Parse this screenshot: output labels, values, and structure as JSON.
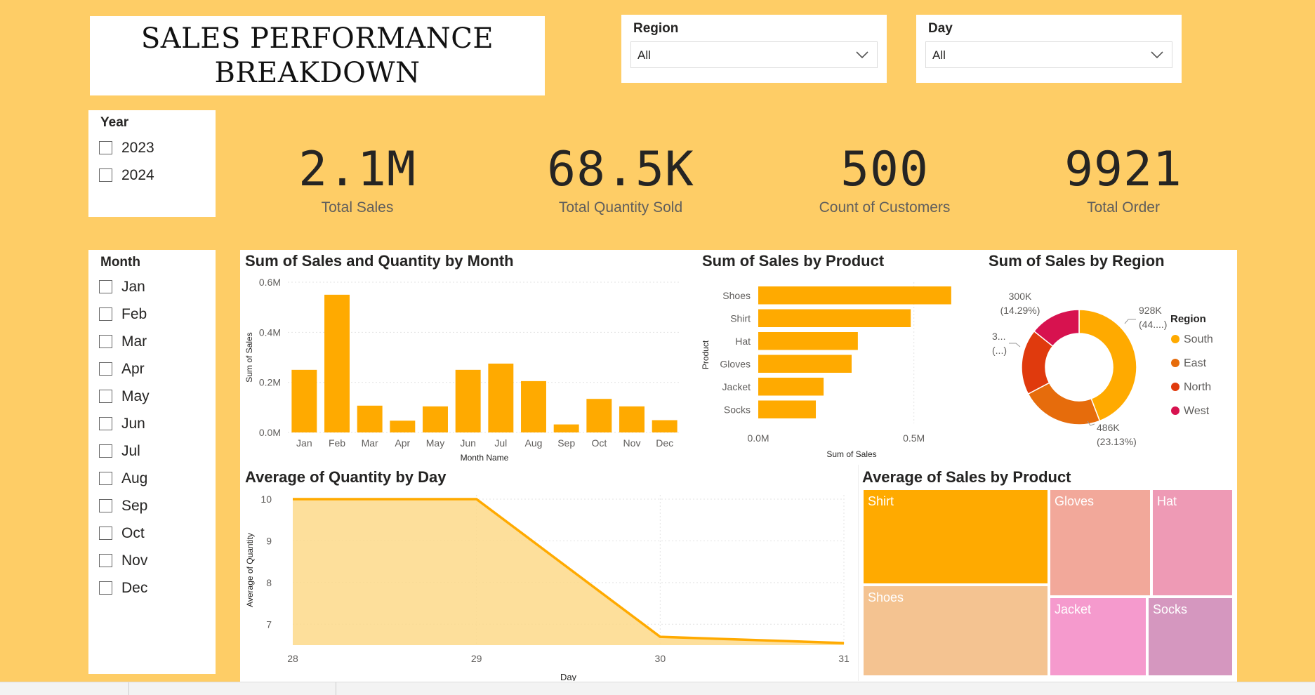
{
  "title": "SALES PERFORMANCE BREAKDOWN",
  "filters": {
    "region": {
      "label": "Region",
      "value": "All"
    },
    "day": {
      "label": "Day",
      "value": "All"
    }
  },
  "year_slicer": {
    "label": "Year",
    "options": [
      "2023",
      "2024"
    ]
  },
  "month_slicer": {
    "label": "Month",
    "options": [
      "Jan",
      "Feb",
      "Mar",
      "Apr",
      "May",
      "Jun",
      "Jul",
      "Aug",
      "Sep",
      "Oct",
      "Nov",
      "Dec"
    ]
  },
  "kpis": [
    {
      "value": "2.1M",
      "label": "Total Sales"
    },
    {
      "value": "68.5K",
      "label": "Total Quantity Sold"
    },
    {
      "value": "500",
      "label": "Count of Customers"
    },
    {
      "value": "9921",
      "label": "Total Order"
    }
  ],
  "colors": {
    "background": "#FECD66",
    "accent": "#FFAA00",
    "area_fill": "#FDD98A",
    "region_south": "#FFAA00",
    "region_east": "#E66C0C",
    "region_north": "#E03A0D",
    "region_west": "#D7124F"
  },
  "chart_data": [
    {
      "type": "bar",
      "title": "Sum of Sales and Quantity by Month",
      "xlabel": "Month Name",
      "ylabel": "Sum of Sales",
      "yticks": [
        "0.0M",
        "0.2M",
        "0.4M",
        "0.6M"
      ],
      "ylim": [
        0,
        0.6
      ],
      "categories": [
        "Jan",
        "Feb",
        "Mar",
        "Apr",
        "May",
        "Jun",
        "Jul",
        "Aug",
        "Sep",
        "Oct",
        "Nov",
        "Dec"
      ],
      "series": [
        {
          "values": [
            0.25,
            0.55,
            0.107,
            0.047,
            0.104,
            0.25,
            0.275,
            0.205,
            0.032,
            0.134,
            0.104,
            0.049
          ]
        }
      ],
      "grid": true
    },
    {
      "type": "bar",
      "orientation": "horizontal",
      "title": "Sum of Sales by Product",
      "xlabel": "Sum of Sales",
      "ylabel": "Product",
      "xticks": [
        "0.0M",
        "0.5M"
      ],
      "xlim": [
        0,
        0.6
      ],
      "categories": [
        "Shoes",
        "Shirt",
        "Hat",
        "Gloves",
        "Jacket",
        "Socks"
      ],
      "values": [
        0.62,
        0.49,
        0.32,
        0.3,
        0.21,
        0.185
      ]
    },
    {
      "type": "pie",
      "variant": "donut",
      "title": "Sum of Sales by Region",
      "legend_title": "Region",
      "legend_position": "right",
      "slices": [
        {
          "name": "South",
          "value": 928,
          "label": "928K",
          "pct_label": "(44....)"
        },
        {
          "name": "East",
          "value": 486,
          "label": "486K",
          "pct_label": "(23.13%)"
        },
        {
          "name": "North",
          "value": 387,
          "label": "3...",
          "pct_label": "(...)"
        },
        {
          "name": "West",
          "value": 300,
          "label": "300K",
          "pct_label": "(14.29%)"
        }
      ]
    },
    {
      "type": "area",
      "title": "Average of Quantity by Day",
      "xlabel": "Day",
      "ylabel": "Average of Quantity",
      "x": [
        28,
        29,
        30,
        31
      ],
      "values": [
        10,
        10,
        6.7,
        6.55
      ],
      "ylim": [
        6.5,
        10.1
      ],
      "yticks": [
        7,
        8,
        9,
        10
      ],
      "grid": true
    },
    {
      "type": "treemap",
      "title": "Average of Sales by Product",
      "items": [
        {
          "name": "Shirt",
          "color": "#FFAA00"
        },
        {
          "name": "Shoes",
          "color": "#F4C391"
        },
        {
          "name": "Gloves",
          "color": "#F2A89A"
        },
        {
          "name": "Hat",
          "color": "#EE9AB5"
        },
        {
          "name": "Jacket",
          "color": "#F59ACD"
        },
        {
          "name": "Socks",
          "color": "#D597BF"
        }
      ]
    }
  ]
}
